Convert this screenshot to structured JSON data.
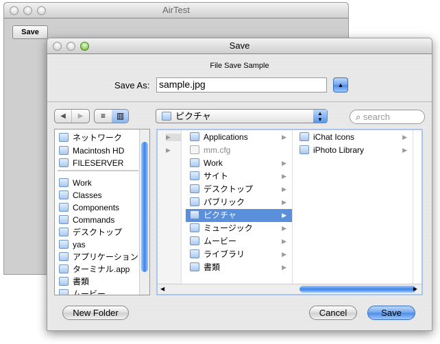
{
  "back_window": {
    "title": "AirTest",
    "save_button": "Save"
  },
  "dialog": {
    "title": "Save",
    "message": "File Save Sample",
    "save_as_label": "Save As:",
    "filename": "sample.jpg",
    "location": "ピクチャ",
    "search_placeholder": "search",
    "sidebar": {
      "devices": [
        "ネットワーク",
        "Macintosh HD",
        "FILESERVER"
      ],
      "places": [
        "Work",
        "Classes",
        "Components",
        "Commands",
        "デスクトップ",
        "yas",
        "アプリケーション",
        "ターミナル.app",
        "書類",
        "ムービー"
      ]
    },
    "column1": [
      {
        "name": "Applications",
        "folder": true
      },
      {
        "name": "mm.cfg",
        "folder": false
      },
      {
        "name": "Work",
        "folder": true
      },
      {
        "name": "サイト",
        "folder": true
      },
      {
        "name": "デスクトップ",
        "folder": true
      },
      {
        "name": "パブリック",
        "folder": true
      },
      {
        "name": "ピクチャ",
        "folder": true,
        "selected": true
      },
      {
        "name": "ミュージック",
        "folder": true
      },
      {
        "name": "ムービー",
        "folder": true
      },
      {
        "name": "ライブラリ",
        "folder": true
      },
      {
        "name": "書類",
        "folder": true
      }
    ],
    "column2": [
      {
        "name": "iChat Icons",
        "folder": true
      },
      {
        "name": "iPhoto Library",
        "folder": true
      }
    ],
    "new_folder_button": "New Folder",
    "cancel_button": "Cancel",
    "save_button": "Save",
    "selection_color": "#5a8fdc"
  }
}
